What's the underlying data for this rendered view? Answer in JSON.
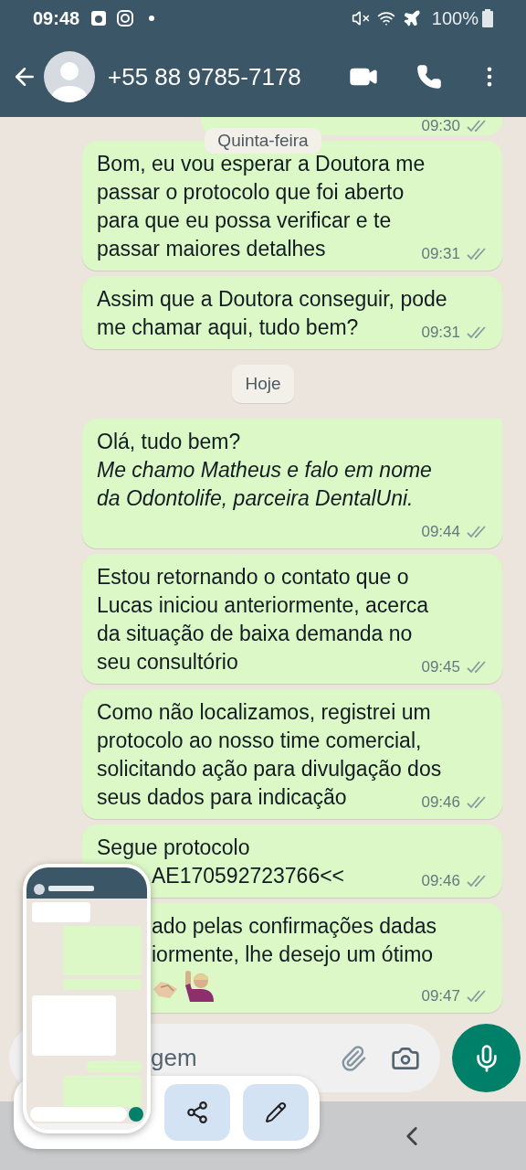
{
  "status_bar": {
    "time": "09:48",
    "battery": "100%"
  },
  "header": {
    "contact": "+55 88 9785-7178"
  },
  "floating_date": "Quinta-feira",
  "messages": [
    {
      "kind": "partial",
      "time": "09:30",
      "read": false
    },
    {
      "kind": "text",
      "tail": false,
      "lines": [
        "Bom, eu vou esperar a Doutora me",
        "passar o protocolo que foi aberto",
        "para que eu possa verificar e te",
        "passar maiores detalhes"
      ],
      "time": "09:31",
      "read": false
    },
    {
      "kind": "text",
      "tail": false,
      "lines": [
        "Assim que a Doutora conseguir, pode",
        "me chamar aqui, tudo bem?"
      ],
      "time": "09:31",
      "read": false
    },
    {
      "kind": "date",
      "label": "Hoje"
    },
    {
      "kind": "text",
      "tail": true,
      "lines": [
        "Olá, tudo bem?",
        "*Me chamo Matheus e falo em nome*",
        "*da Odontolife, parceira DentalUni.*"
      ],
      "time": "09:44",
      "read": false
    },
    {
      "kind": "text",
      "tail": false,
      "lines": [
        "Estou retornando o contato que o",
        "Lucas iniciou anteriormente, acerca",
        "da situação de baixa demanda no",
        "seu consultório"
      ],
      "time": "09:45",
      "read": false
    },
    {
      "kind": "text",
      "tail": false,
      "lines": [
        "Como não localizamos, registrei um",
        "protocolo ao nosso time comercial,",
        "solicitando ação para divulgação dos",
        "seus dados para indicação"
      ],
      "time": "09:46",
      "read": false
    },
    {
      "kind": "text",
      "tail": false,
      "lines": [
        "Segue protocolo"
      ],
      "covered_lines": [
        "AE170592723766<<"
      ],
      "time": "09:46",
      "read": false
    },
    {
      "kind": "text",
      "tail": false,
      "covered_lines": [
        "ado pelas confirmações dadas",
        "iormente, lhe desejo um ótimo"
      ],
      "emoji": true,
      "time": "09:47",
      "read": false
    }
  ],
  "composer": {
    "placeholder": "gem"
  }
}
